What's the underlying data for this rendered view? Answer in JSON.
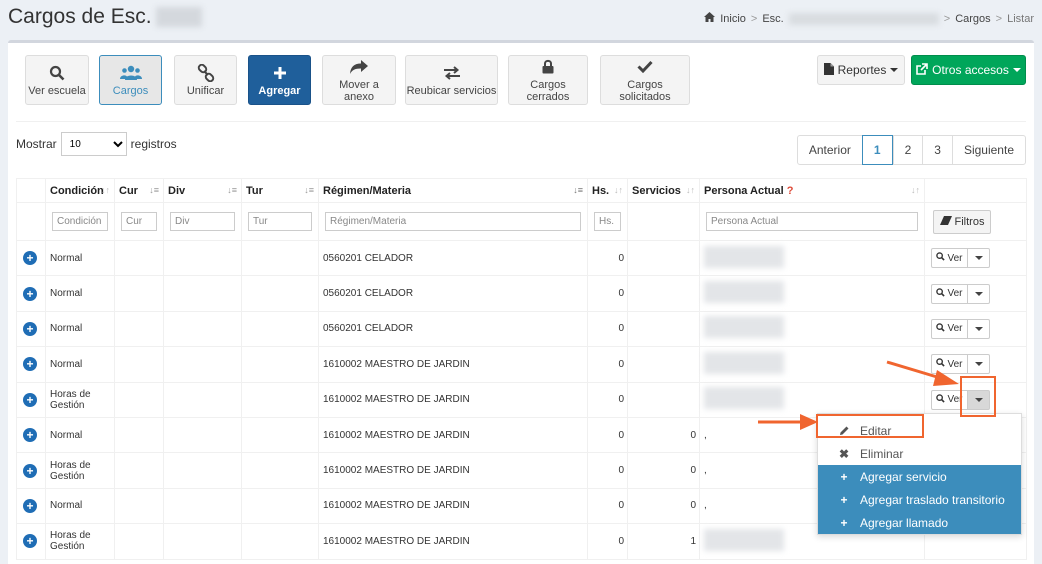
{
  "header": {
    "title": "Cargos de Esc.",
    "breadcrumb": [
      "Inicio",
      "Esc.",
      "Cargos",
      "Listar"
    ]
  },
  "toolbar": {
    "buttons": [
      {
        "label": "Ver escuela",
        "icon": "search-icon"
      },
      {
        "label": "Cargos",
        "icon": "users-icon"
      },
      {
        "label": "Unificar",
        "icon": "link-icon"
      },
      {
        "label": "Agregar",
        "icon": "plus-icon"
      },
      {
        "label": "Mover a anexo",
        "icon": "share-icon"
      },
      {
        "label": "Reubicar servicios",
        "icon": "exchange-icon"
      },
      {
        "label": "Cargos cerrados",
        "icon": "lock-icon"
      },
      {
        "label": "Cargos solicitados",
        "icon": "check-icon"
      }
    ],
    "reportes_label": "Reportes",
    "otros_label": "Otros accesos"
  },
  "length": {
    "prefix": "Mostrar",
    "value": "10",
    "suffix": "registros"
  },
  "pagination": {
    "prev": "Anterior",
    "pages": [
      "1",
      "2",
      "3"
    ],
    "next": "Siguiente",
    "current": "1"
  },
  "table": {
    "headers": [
      "Condición",
      "Cur",
      "Div",
      "Tur",
      "Régimen/Materia",
      "Hs.",
      "Servicios",
      "Persona Actual"
    ],
    "required_mark": "?",
    "filters": {
      "condicion": "Condición",
      "cur": "Cur",
      "div": "Div",
      "tur": "Tur",
      "regimen": "Régimen/Materia",
      "hs": "Hs.",
      "persona": "Persona Actual",
      "button": "Filtros"
    },
    "rows": [
      {
        "condicion": "Normal",
        "regimen": "0560201 CELADOR",
        "hs": "0",
        "servicios": "",
        "persona": ""
      },
      {
        "condicion": "Normal",
        "regimen": "0560201 CELADOR",
        "hs": "0",
        "servicios": "",
        "persona": ""
      },
      {
        "condicion": "Normal",
        "regimen": "0560201 CELADOR",
        "hs": "0",
        "servicios": "",
        "persona": ""
      },
      {
        "condicion": "Normal",
        "regimen": "1610002 MAESTRO DE JARDIN",
        "hs": "0",
        "servicios": "",
        "persona": ""
      },
      {
        "condicion": "Horas de Gestión",
        "regimen": "1610002 MAESTRO DE JARDIN",
        "hs": "0",
        "servicios": "",
        "persona": ""
      },
      {
        "condicion": "Normal",
        "regimen": "1610002 MAESTRO DE JARDIN",
        "hs": "0",
        "servicios": "0",
        "persona": ","
      },
      {
        "condicion": "Horas de Gestión",
        "regimen": "1610002 MAESTRO DE JARDIN",
        "hs": "0",
        "servicios": "0",
        "persona": ","
      },
      {
        "condicion": "Normal",
        "regimen": "1610002 MAESTRO DE JARDIN",
        "hs": "0",
        "servicios": "0",
        "persona": ","
      },
      {
        "condicion": "Horas de Gestión",
        "regimen": "1610002 MAESTRO DE JARDIN",
        "hs": "0",
        "servicios": "1",
        "persona": ""
      }
    ],
    "ver_label": "Ver"
  },
  "menu": {
    "items": [
      {
        "label": "Editar",
        "icon": "pencil-icon"
      },
      {
        "label": "Eliminar",
        "icon": "times-icon"
      },
      {
        "label": "Agregar servicio",
        "icon": "plus-icon"
      },
      {
        "label": "Agregar traslado transitorio",
        "icon": "plus-icon"
      },
      {
        "label": "Agregar llamado",
        "icon": "plus-icon"
      }
    ]
  },
  "colors": {
    "primary": "#1f5f9b",
    "success": "#00a65a",
    "highlight": "#3c8dbc",
    "annotation": "#f0652f"
  }
}
